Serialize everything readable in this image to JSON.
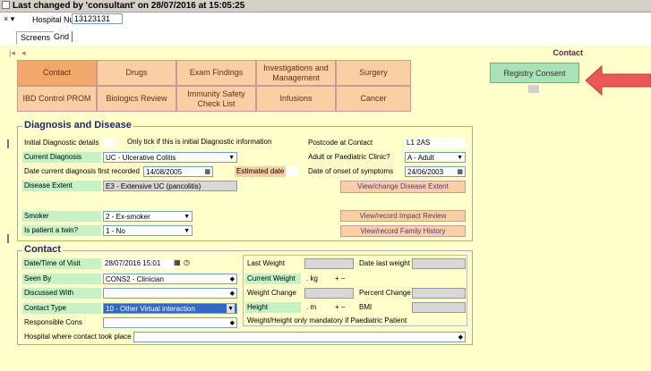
{
  "header": {
    "last_changed": "Last changed by 'consultant' on 28/07/2016 at 15:05:25"
  },
  "hospital": {
    "controls": "× ▾",
    "label": "Hospital Number",
    "number": "13123131"
  },
  "view_tabs": [
    "Screens",
    "Grid"
  ],
  "nav": {
    "first": "|◂",
    "prev": "◂",
    "title": "Contact"
  },
  "screen_buttons": [
    [
      "Contact",
      "Drugs",
      "Exam Findings",
      "Investigations and Management",
      "Surgery"
    ],
    [
      "IBD Control PROM",
      "Biologics Review",
      "Immunity Safety Check List",
      "Infusions",
      "Cancer"
    ]
  ],
  "registry_button": "Registry Consent",
  "accent_colors": {
    "button": "#fbcfa4",
    "active": "#f2a86a",
    "label_green": "#c6f2c6",
    "registry": "#a9e2b6",
    "arrow": "#e85a5a",
    "bg": "#ffffcc"
  },
  "diagnosis": {
    "title": "Diagnosis and Disease",
    "initial_label": "Initial Diagnostic details",
    "initial_note": "Only tick if this is initial Diagnostic information",
    "postcode_label": "Postcode at Contact",
    "postcode": "L1 2AS",
    "current_dx_label": "Current Diagnosis",
    "current_dx": "UC - Ulcerative Colitis",
    "clinic_label": "Adult or Paediatric Clinic?",
    "clinic": "A - Adult",
    "dx_date_label": "Date current diagnosis first recorded",
    "dx_date": "14/08/2005",
    "estimated_label": "Estimated date",
    "onset_label": "Date of onset of symptoms",
    "onset": "24/06/2003",
    "extent_label": "Disease Extent",
    "extent": "E3 - Extensive UC (pancolitis)",
    "extent_btn": "View/change Disease Extent",
    "smoker_label": "Smoker",
    "smoker": "2 - Ex-smoker",
    "impact_btn": "View/record Impact Review",
    "twin_label": "Is patient a twin?",
    "twin": "1 - No",
    "family_btn": "View/record Family History"
  },
  "contact": {
    "title": "Contact",
    "visit_label": "Date/Time of Visit",
    "visit": "28/07/2016 15:01",
    "seen_label": "Seen By",
    "seen": "CONS2 - Clinician",
    "discussed_label": "Discussed With",
    "discussed": "",
    "type_label": "Contact Type",
    "type": "10 - Other Virtual interaction",
    "resp_label": "Responsible Cons",
    "resp": "",
    "where_label": "Hospital where contact took place",
    "where": "",
    "last_weight_label": "Last Weight",
    "date_last_weight_label": "Date last weight",
    "current_weight_label": "Current Weight",
    "weight_unit": ". kg",
    "weight_change_label": "Weight Change",
    "percent_change_label": "Percent Change",
    "height_label": "Height",
    "height_unit": ". m",
    "bmi_label": "BMI",
    "peds_note": "Weight/Height only mandatory if Paediatric Patient",
    "plus_minus": "+ −"
  },
  "icons": [
    "calendar-icon",
    "clock-icon",
    "dropdown-arrow-icon",
    "diamond-icon",
    "arrow-left-icon"
  ]
}
